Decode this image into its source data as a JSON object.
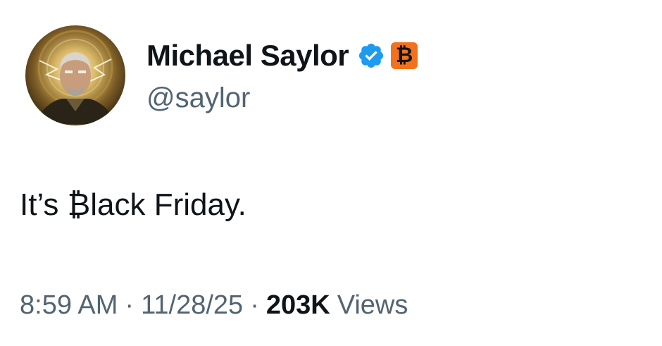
{
  "author": {
    "display_name": "Michael Saylor",
    "handle": "@saylor",
    "verified_icon": "verified-badge-icon",
    "affiliate_badge": "₿",
    "colors": {
      "verified_blue": "#1d9bf0",
      "badge_orange": "#f2711c"
    }
  },
  "tweet": {
    "text": "It’s ₿lack Friday."
  },
  "meta": {
    "time": "8:59 AM",
    "separator": "·",
    "date": "11/28/25",
    "views_count": "203K",
    "views_label": "Views"
  }
}
